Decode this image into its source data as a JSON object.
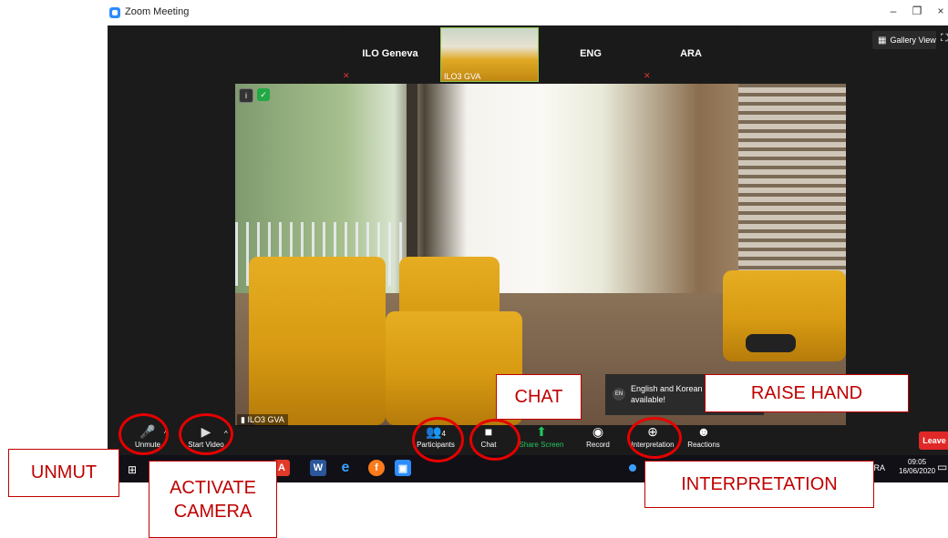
{
  "window": {
    "title": "Zoom Meeting",
    "minimize": "–",
    "restore": "❐",
    "close": "×"
  },
  "filmstrip": {
    "tiles": [
      {
        "name": "ILO Geneva"
      },
      {
        "name": "ILO3 GVA"
      },
      {
        "name": "ENG"
      },
      {
        "name": "ARA"
      }
    ]
  },
  "gallery_view": "Gallery View",
  "main_video": {
    "label": "ILO3 GVA"
  },
  "notification": {
    "text": "English and Korean ... available!",
    "badge": "EN"
  },
  "toolbar": {
    "unmute": "Unmute",
    "start_video": "Start Video",
    "participants": "Participants",
    "participants_count": "4",
    "chat": "Chat",
    "share_screen": "Share Screen",
    "record": "Record",
    "interpretation": "Interpretation",
    "reactions": "Reactions",
    "leave": "Leave"
  },
  "taskbar": {
    "lang": "FRA",
    "time": "09:05",
    "date": "16/06/2020"
  },
  "annotations": {
    "unmute": "UNMUT",
    "activate_camera_line1": "ACTIVATE",
    "activate_camera_line2": "CAMERA",
    "chat": "CHAT",
    "raise_hand": "RAISE HAND",
    "interpretation": "INTERPRETATION"
  },
  "colors": {
    "accent": "#2D8CFF",
    "annotation": "#e60000",
    "leave": "#e02828",
    "share": "#22c55e"
  }
}
